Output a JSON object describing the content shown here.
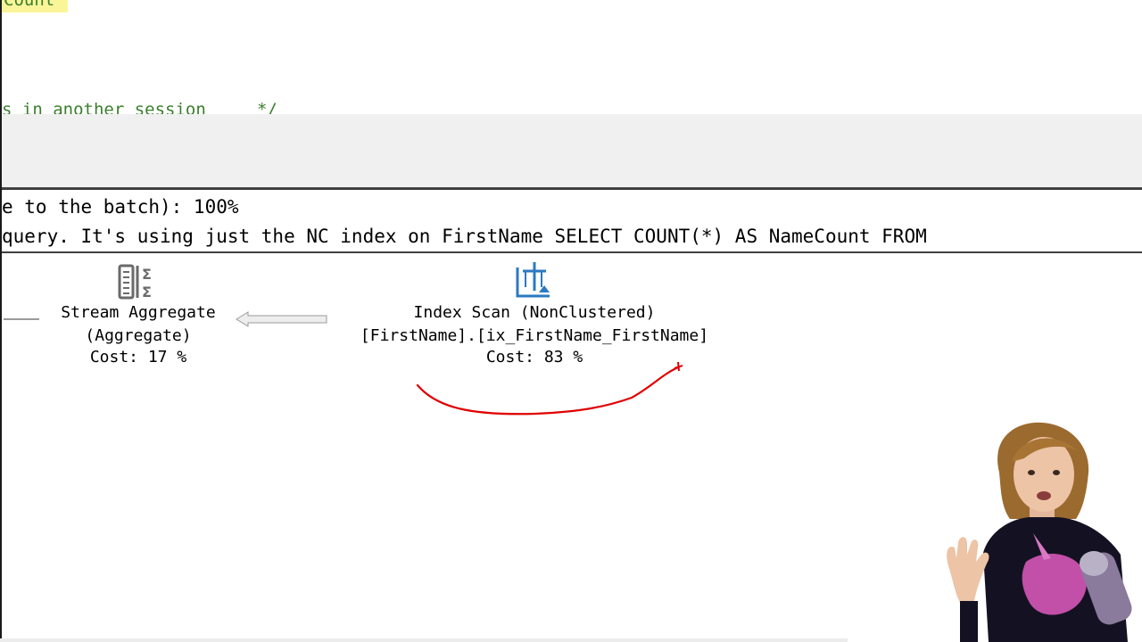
{
  "editor": {
    "highlighted_token": "Count",
    "comment_line": "s in another session     */"
  },
  "results": {
    "query_cost_line": "e to the batch): 100%",
    "query_text_line": "query. It's using just the NC index on FirstName SELECT COUNT(*) AS NameCount FROM"
  },
  "plan": {
    "stream_aggregate": {
      "name": "Stream Aggregate",
      "subtitle": "(Aggregate)",
      "cost": "Cost: 17 %",
      "icon": "stream-aggregate-icon"
    },
    "index_scan": {
      "name": "Index Scan (NonClustered)",
      "object": "[FirstName].[ix_FirstName_FirstName]",
      "cost": "Cost: 83 %",
      "icon": "index-scan-icon"
    }
  },
  "colors": {
    "comment": "#3a7f2c",
    "highlight": "#fbf59a",
    "annotation": "#e00000",
    "index_icon": "#2b79c2",
    "aggregate_icon": "#6a6a6a"
  }
}
